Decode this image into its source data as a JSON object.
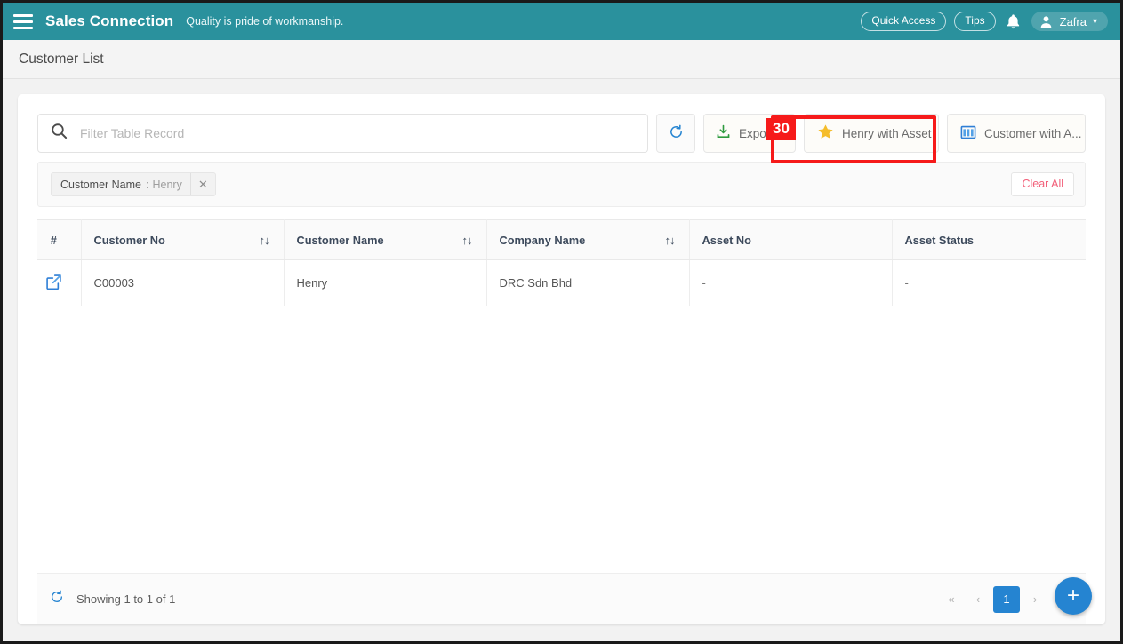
{
  "topnav": {
    "brand": "Sales Connection",
    "tagline": "Quality is pride of workmanship.",
    "quick_access_label": "Quick Access",
    "tips_label": "Tips",
    "user_name": "Zafra",
    "caret": "⌄",
    "icons": {
      "menu": "hamburger-icon",
      "bell": "notification-bell-icon",
      "user": "user-avatar-icon"
    }
  },
  "page": {
    "title": "Customer List"
  },
  "toolbar": {
    "search_placeholder": "Filter Table Record",
    "search_value": "",
    "refresh_label": "",
    "export_label": "Export",
    "henry_with_asset_label": "Henry with Asset",
    "customer_with_asset_label": "Customer with A...",
    "icons": {
      "search": "search-icon",
      "refresh": "refresh-icon",
      "export": "download-icon",
      "favorite": "star-icon",
      "columns": "columns-icon"
    }
  },
  "annotation": {
    "badge": "30",
    "color": "#f61a1a",
    "target": "henry-with-asset-button"
  },
  "filters": {
    "chips": [
      {
        "label": "Customer Name",
        "separator": ":",
        "value": "Henry",
        "remove": "✕"
      }
    ],
    "clear_all_label": "Clear All"
  },
  "table": {
    "columns": [
      {
        "key": "hash",
        "label": "#",
        "sortable": false
      },
      {
        "key": "cno",
        "label": "Customer No",
        "sortable": true
      },
      {
        "key": "cname",
        "label": "Customer Name",
        "sortable": true
      },
      {
        "key": "comp",
        "label": "Company Name",
        "sortable": true
      },
      {
        "key": "ano",
        "label": "Asset No",
        "sortable": false
      },
      {
        "key": "astat",
        "label": "Asset Status",
        "sortable": false
      }
    ],
    "sort_glyph": "↑↓",
    "rows": [
      {
        "open_icon": "open-in-new-icon",
        "cno": "C00003",
        "cname": "Henry",
        "comp": "DRC Sdn Bhd",
        "ano": "-",
        "astat": "-"
      }
    ]
  },
  "footer": {
    "refresh_icon": "refresh-icon",
    "showing": "Showing 1 to 1 of 1",
    "pager": {
      "first": "«",
      "prev": "‹",
      "pages": [
        "1"
      ],
      "current": "1",
      "next": "›",
      "last": "»"
    }
  },
  "fab": {
    "label": "+",
    "icon": "plus-icon",
    "color": "#2584d1"
  },
  "colors": {
    "header_teal": "#2a919d",
    "accent_blue": "#2584d1",
    "highlight_red": "#f61a1a",
    "clear_all_pink": "#f2607a",
    "star_gold": "#f5bd2b",
    "export_green": "#2e9b3f"
  }
}
